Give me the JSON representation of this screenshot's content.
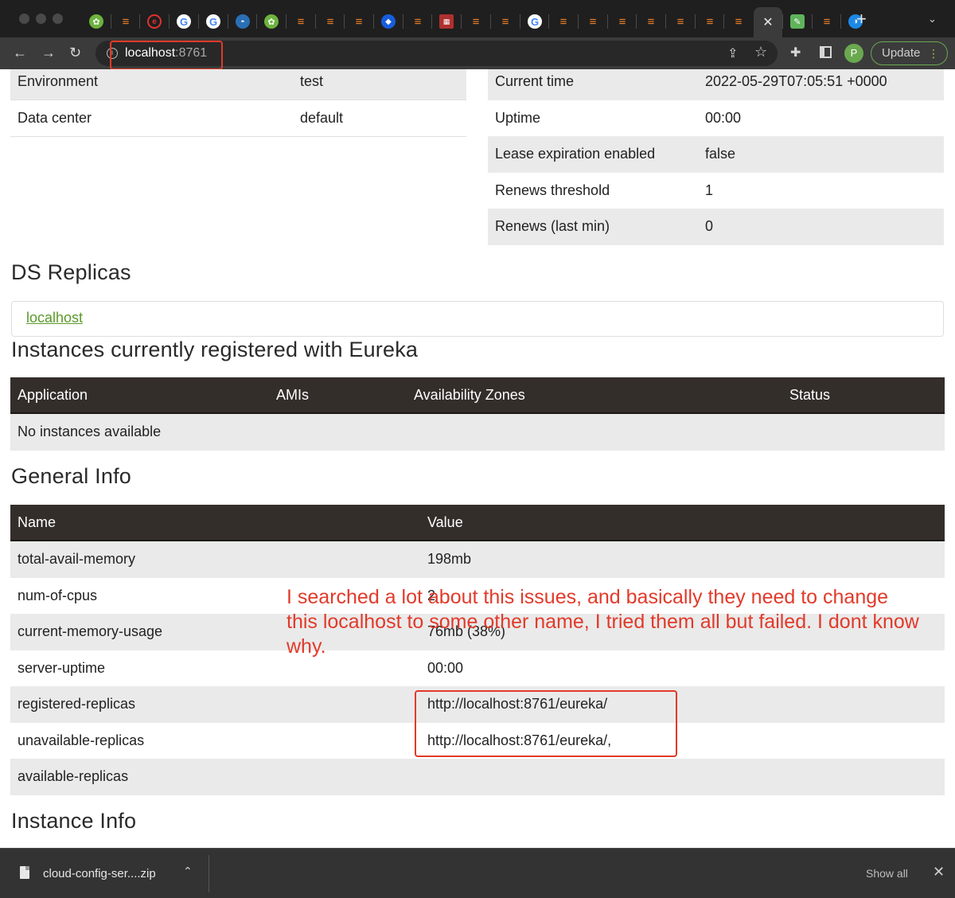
{
  "browser": {
    "tabs": [
      {
        "icon": "spring-leaf-icon",
        "glyph": "✿",
        "kind": "spring"
      },
      {
        "icon": "stackoverflow-icon",
        "glyph": "≡",
        "kind": "so"
      },
      {
        "icon": "red-e-icon",
        "glyph": "e",
        "kind": "red"
      },
      {
        "icon": "google-icon",
        "glyph": "G",
        "kind": "google"
      },
      {
        "icon": "google-icon",
        "glyph": "G",
        "kind": "google"
      },
      {
        "icon": "docker-icon",
        "glyph": "◓",
        "kind": "docker"
      },
      {
        "icon": "spring-leaf-icon",
        "glyph": "✿",
        "kind": "spring"
      },
      {
        "icon": "stackoverflow-icon",
        "glyph": "≡",
        "kind": "so"
      },
      {
        "icon": "stackoverflow-icon",
        "glyph": "≡",
        "kind": "so"
      },
      {
        "icon": "stackoverflow-icon",
        "glyph": "≡",
        "kind": "so"
      },
      {
        "icon": "bitwarden-icon",
        "glyph": "◆",
        "kind": "bitwarden"
      },
      {
        "icon": "stackoverflow-icon",
        "glyph": "≡",
        "kind": "so"
      },
      {
        "icon": "grid-icon",
        "glyph": "▦",
        "kind": "grid"
      },
      {
        "icon": "stackoverflow-icon",
        "glyph": "≡",
        "kind": "so"
      },
      {
        "icon": "stackoverflow-icon",
        "glyph": "≡",
        "kind": "so"
      },
      {
        "icon": "google-icon",
        "glyph": "G",
        "kind": "google"
      },
      {
        "icon": "stackoverflow-icon",
        "glyph": "≡",
        "kind": "so"
      },
      {
        "icon": "stackoverflow-icon",
        "glyph": "≡",
        "kind": "so"
      },
      {
        "icon": "stackoverflow-icon",
        "glyph": "≡",
        "kind": "so"
      },
      {
        "icon": "stackoverflow-icon",
        "glyph": "≡",
        "kind": "so"
      },
      {
        "icon": "stackoverflow-icon",
        "glyph": "≡",
        "kind": "so"
      },
      {
        "icon": "stackoverflow-icon",
        "glyph": "≡",
        "kind": "so"
      },
      {
        "icon": "stackoverflow-icon",
        "glyph": "≡",
        "kind": "so"
      },
      {
        "icon": "close-icon",
        "glyph": "✕",
        "kind": "active"
      },
      {
        "icon": "leaf-icon",
        "glyph": "✎",
        "kind": "leaf"
      },
      {
        "icon": "stackoverflow-icon",
        "glyph": "≡",
        "kind": "so"
      },
      {
        "icon": "blue-leaf-icon",
        "glyph": "◑",
        "kind": "blueleaf"
      }
    ],
    "new_tab_glyph": "+",
    "tab_menu_glyph": "⌄",
    "back_glyph": "←",
    "forward_glyph": "→",
    "reload_glyph": "↻",
    "info_glyph": "i",
    "url_host": "localhost",
    "url_port": ":8761",
    "share_glyph": "⇪",
    "star_glyph": "☆",
    "extensions_glyph": "✚",
    "avatar_letter": "P",
    "update_label": "Update",
    "update_menu_glyph": "⋮",
    "accent_color": "#6aa84f"
  },
  "system_status": {
    "left": [
      {
        "name": "Environment",
        "value": "test"
      },
      {
        "name": "Data center",
        "value": "default"
      }
    ],
    "right": [
      {
        "name": "Current time",
        "value": "2022-05-29T07:05:51 +0000"
      },
      {
        "name": "Uptime",
        "value": "00:00"
      },
      {
        "name": "Lease expiration enabled",
        "value": "false"
      },
      {
        "name": "Renews threshold",
        "value": "1"
      },
      {
        "name": "Renews (last min)",
        "value": "0"
      }
    ]
  },
  "ds_replicas": {
    "title": "DS Replicas",
    "link": "localhost"
  },
  "instances": {
    "title": "Instances currently registered with Eureka",
    "columns": [
      "Application",
      "AMIs",
      "Availability Zones",
      "Status"
    ],
    "empty_message": "No instances available"
  },
  "general_info": {
    "title": "General Info",
    "columns": [
      "Name",
      "Value"
    ],
    "rows": [
      {
        "name": "total-avail-memory",
        "value": "198mb"
      },
      {
        "name": "num-of-cpus",
        "value": "2"
      },
      {
        "name": "current-memory-usage",
        "value": "76mb (38%)"
      },
      {
        "name": "server-uptime",
        "value": "00:00"
      },
      {
        "name": "registered-replicas",
        "value": "http://localhost:8761/eureka/"
      },
      {
        "name": "unavailable-replicas",
        "value": "http://localhost:8761/eureka/,"
      },
      {
        "name": "available-replicas",
        "value": ""
      }
    ]
  },
  "instance_info": {
    "title": "Instance Info"
  },
  "annotation": {
    "text": "I searched a lot about this issues, and basically they need to change this localhost to some other name, I tried them all but failed. I dont know why.",
    "color": "#e23a2a"
  },
  "download_bar": {
    "file_name": "cloud-config-ser....zip",
    "chevron_glyph": "⌃",
    "show_all_label": "Show all",
    "close_glyph": "✕"
  }
}
